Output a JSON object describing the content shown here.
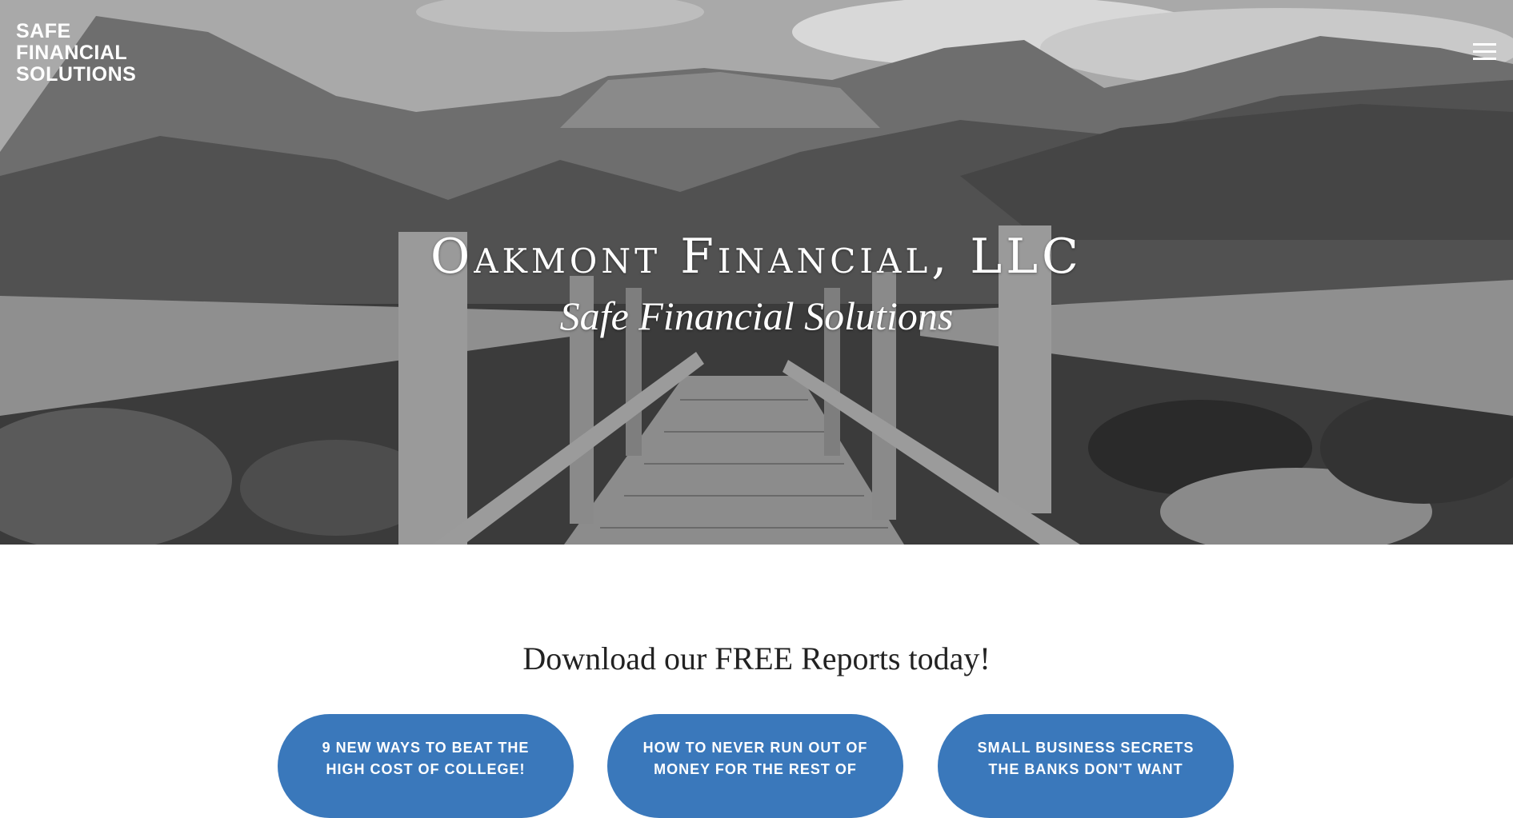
{
  "header": {
    "brand_lines": [
      "SAFE",
      "FINANCIAL",
      "SOLUTIONS"
    ],
    "menu_icon": "hamburger-menu-icon"
  },
  "hero": {
    "title": "Oakmont Financial, LLC",
    "subtitle": "Safe Financial Solutions",
    "image_style": "black-and-white mountain landscape with wooden footbridge"
  },
  "reports": {
    "heading": "Download our FREE Reports today!",
    "buttons": [
      {
        "label": "9 NEW WAYS TO BEAT THE HIGH COST OF COLLEGE!"
      },
      {
        "label": "HOW TO NEVER RUN OUT OF MONEY FOR THE REST OF"
      },
      {
        "label": "SMALL BUSINESS SECRETS THE BANKS DON'T WANT"
      }
    ]
  },
  "colors": {
    "button": "#3a78bb",
    "heading_text": "#222222",
    "page_background": "#ffffff"
  }
}
